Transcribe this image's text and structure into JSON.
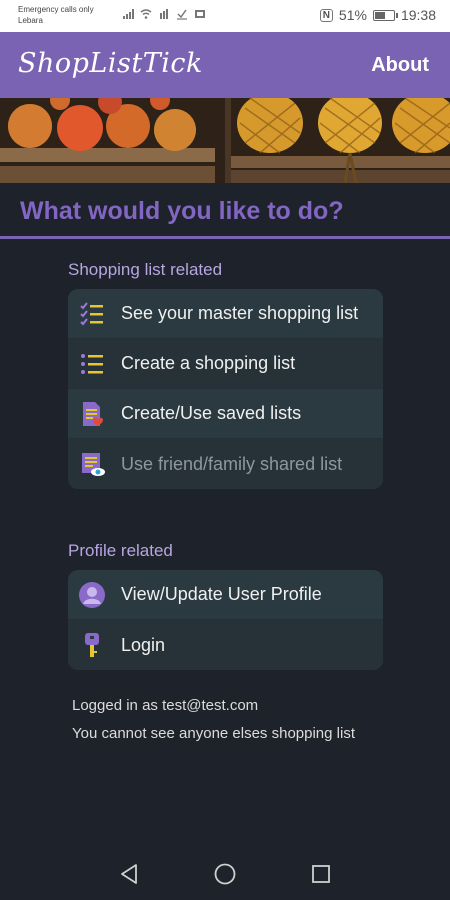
{
  "status_bar": {
    "carrier_line1": "Emergency calls only",
    "carrier_line2": "Lebara",
    "battery": "51%",
    "time": "19:38",
    "nfc_icon": "N"
  },
  "app": {
    "title": "ShopListTick",
    "about_label": "About",
    "brand_color": "#7b63b3"
  },
  "heading": "What would you like to do?",
  "shopping_section": {
    "label": "Shopping list related",
    "items": [
      {
        "label": "See your master shopping list",
        "icon": "checklist-icon"
      },
      {
        "label": "Create a shopping list",
        "icon": "list-icon"
      },
      {
        "label": "Create/Use saved lists",
        "icon": "saved-list-icon"
      },
      {
        "label": "Use friend/family shared list",
        "icon": "shared-list-icon"
      }
    ]
  },
  "profile_section": {
    "label": "Profile related",
    "items": [
      {
        "label": "View/Update User Profile",
        "icon": "user-icon"
      },
      {
        "label": "Login",
        "icon": "key-icon"
      }
    ]
  },
  "info": {
    "logged_in": "Logged in as test@test.com",
    "note": "You cannot see anyone elses shopping list"
  }
}
